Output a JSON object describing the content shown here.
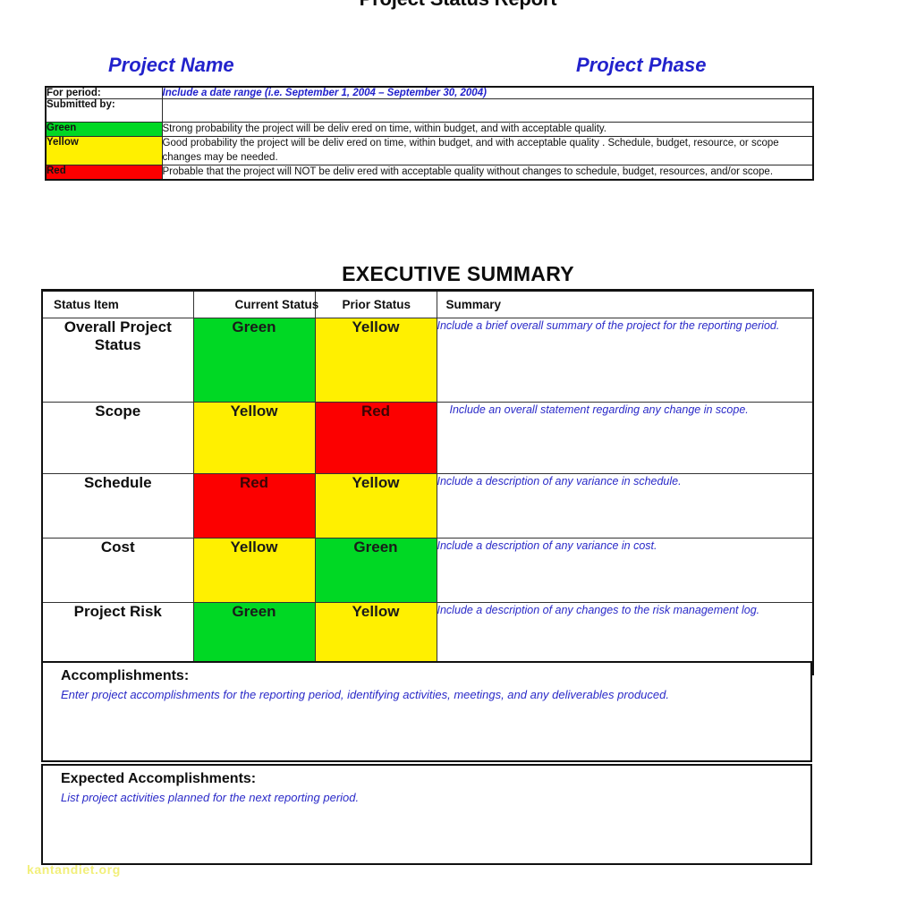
{
  "document": {
    "title": "Project Status Report",
    "project_name_heading": "Project Name",
    "project_phase_heading": "Project Phase",
    "watermark": "kantandiet.org"
  },
  "colors": {
    "green": "#00D824",
    "yellow": "#FFF000",
    "red": "#FC0000",
    "blue_text": "#2222CC",
    "black_text": "#101010",
    "watermark": "#F2EF7A"
  },
  "header_table": {
    "rows": [
      {
        "label": "For period:",
        "value": "Include a date range (i.e. September 1, 2004 – September 30, 2004)"
      },
      {
        "label": "Submitted by:",
        "value": ""
      }
    ],
    "legend": [
      {
        "name": "Green",
        "color": "green",
        "description": "Strong probability  the project will be deliv ered on time, within budget, and with acceptable quality."
      },
      {
        "name": "Yellow",
        "color": "yellow",
        "description": "Good probability the project will be deliv ered on time, within budget, and with acceptable quality . Schedule, budget, resource, or scope changes may be needed."
      },
      {
        "name": "Red",
        "color": "red",
        "description": "Probable that the project will NOT be deliv ered with acceptable quality without changes to schedule, budget, resources, and/or scope."
      }
    ]
  },
  "executive_summary": {
    "section_title": "EXECUTIVE SUMMARY",
    "columns": [
      "Status Item",
      "Current Status",
      "Prior Status",
      "Summary"
    ],
    "rows": [
      {
        "item": "Overall Project Status",
        "item_line1": "Overall Project",
        "item_line2": "Status",
        "current_status": "Green",
        "current_color": "green",
        "prior_status": "Yellow",
        "prior_color": "yellow",
        "summary": "Include a brief overall summary of the project for the reporting period."
      },
      {
        "item": "Scope",
        "item_line1": "Scope",
        "item_line2": "",
        "current_status": "Yellow",
        "current_color": "yellow",
        "prior_status": "Red",
        "prior_color": "red",
        "summary": "Include an overall statement regarding any change in scope."
      },
      {
        "item": "Schedule",
        "item_line1": "Schedule",
        "item_line2": "",
        "current_status": "Red",
        "current_color": "red",
        "prior_status": "Yellow",
        "prior_color": "yellow",
        "summary": "Include a description of any variance in schedule."
      },
      {
        "item": "Cost",
        "item_line1": "Cost",
        "item_line2": "",
        "current_status": "Yellow",
        "current_color": "yellow",
        "prior_status": "Green",
        "prior_color": "green",
        "summary": "Include a description of any variance in cost."
      },
      {
        "item": "Project Risk",
        "item_line1": "Project Risk",
        "item_line2": "",
        "current_status": "Green",
        "current_color": "green",
        "prior_status": "Yellow",
        "prior_color": "yellow",
        "summary": "Include a description of any changes to the risk management log."
      }
    ]
  },
  "accomplishments": {
    "title": "Accomplishments:",
    "body": "Enter project accomplishments for the reporting period, identifying activities, meetings, and any deliverables produced."
  },
  "expected_accomplishments": {
    "title": "Expected Accomplishments:",
    "body": "List project activities planned for the next reporting period."
  }
}
